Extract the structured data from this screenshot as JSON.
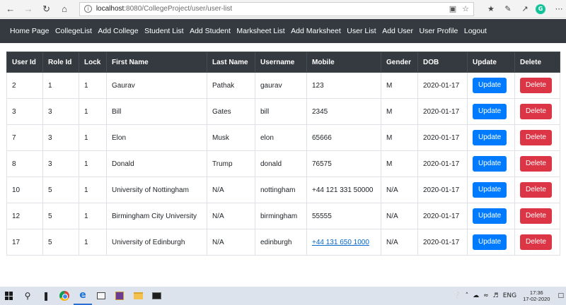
{
  "browser": {
    "url_host": "localhost",
    "url_path": ":8080/CollegeProject/user/user-list"
  },
  "navbar": {
    "items": [
      "Home Page",
      "CollegeList",
      "Add College",
      "Student List",
      "Add Student",
      "Marksheet List",
      "Add Marksheet",
      "User List",
      "Add User",
      "User Profile",
      "Logout"
    ]
  },
  "table": {
    "headers": [
      "User Id",
      "Role Id",
      "Lock",
      "First Name",
      "Last Name",
      "Username",
      "Mobile",
      "Gender",
      "DOB",
      "Update",
      "Delete"
    ],
    "update_label": "Update",
    "delete_label": "Delete",
    "rows": [
      {
        "user_id": "2",
        "role_id": "1",
        "lock": "1",
        "first_name": "Gaurav",
        "last_name": "Pathak",
        "username": "gaurav",
        "mobile": "123",
        "gender": "M",
        "dob": "2020-01-17"
      },
      {
        "user_id": "3",
        "role_id": "3",
        "lock": "1",
        "first_name": "Bill",
        "last_name": "Gates",
        "username": "bill",
        "mobile": "2345",
        "gender": "M",
        "dob": "2020-01-17"
      },
      {
        "user_id": "7",
        "role_id": "3",
        "lock": "1",
        "first_name": "Elon",
        "last_name": "Musk",
        "username": "elon",
        "mobile": "65666",
        "gender": "M",
        "dob": "2020-01-17"
      },
      {
        "user_id": "8",
        "role_id": "3",
        "lock": "1",
        "first_name": "Donald",
        "last_name": "Trump",
        "username": "donald",
        "mobile": "76575",
        "gender": "M",
        "dob": "2020-01-17"
      },
      {
        "user_id": "10",
        "role_id": "5",
        "lock": "1",
        "first_name": "University of Nottingham",
        "last_name": "N/A",
        "username": "nottingham",
        "mobile": "+44 121 331 50000",
        "gender": "N/A",
        "dob": "2020-01-17"
      },
      {
        "user_id": "12",
        "role_id": "5",
        "lock": "1",
        "first_name": "Birmingham City University",
        "last_name": "N/A",
        "username": "birmingham",
        "mobile": "55555",
        "gender": "N/A",
        "dob": "2020-01-17"
      },
      {
        "user_id": "17",
        "role_id": "5",
        "lock": "1",
        "first_name": "University of Edinburgh",
        "last_name": "N/A",
        "username": "edinburgh",
        "mobile": "+44 131 650 1000",
        "mobile_is_link": true,
        "gender": "N/A",
        "dob": "2020-01-17"
      }
    ]
  },
  "taskbar": {
    "language": "ENG",
    "time": "17:36",
    "date": "17-02-2020"
  },
  "colors": {
    "navbar_bg": "#343a40",
    "update_button": "#007bff",
    "delete_button": "#dc3545"
  }
}
